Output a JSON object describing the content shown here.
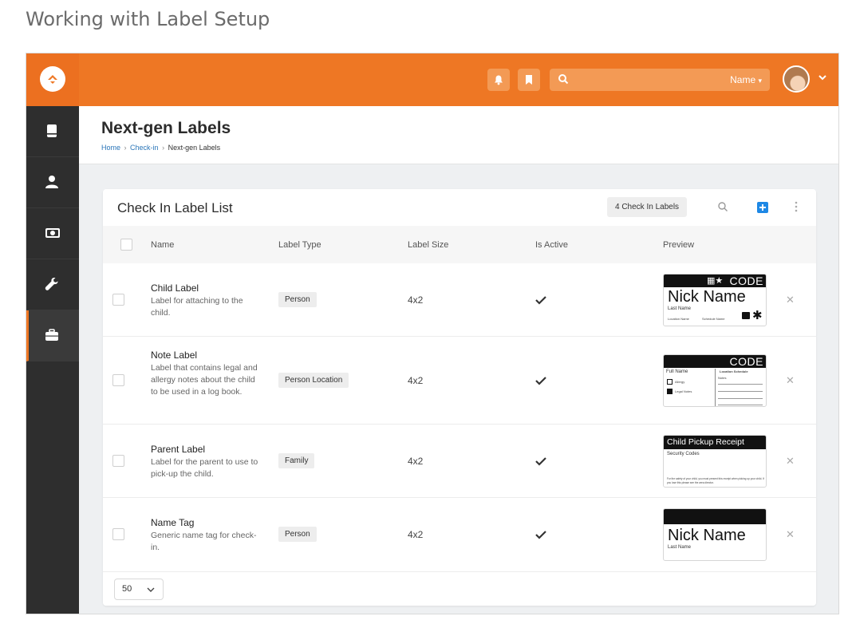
{
  "doc_title": "Working with Label Setup",
  "header": {
    "search_scope": "Name"
  },
  "page": {
    "title": "Next-gen Labels",
    "breadcrumb": [
      "Home",
      "Check-in",
      "Next-gen Labels"
    ]
  },
  "panel": {
    "title": "Check In Label List",
    "count_badge": "4 Check In Labels",
    "columns": [
      "Name",
      "Label Type",
      "Label Size",
      "Is Active",
      "Preview"
    ]
  },
  "rows": [
    {
      "name": "Child Label",
      "description": "Label for attaching to the child.",
      "type": "Person",
      "size": "4x2",
      "preview": {
        "code": "CODE",
        "big": "Nick Name",
        "line2": "Last Name",
        "f1": "Location Name",
        "f2": "Schedule Name"
      }
    },
    {
      "name": "Note Label",
      "description": "Label that contains legal and allergy notes about the child to be used in a log book.",
      "type": "Person Location",
      "size": "4x2",
      "preview": {
        "code": "CODE",
        "full_name": "Full Name",
        "loc": "Location Schedule",
        "allergy": "Allergy",
        "legal": "Legal Notes",
        "notes": "Notes"
      }
    },
    {
      "name": "Parent Label",
      "description": "Label for the parent to use to pick-up the child.",
      "type": "Family",
      "size": "4x2",
      "preview": {
        "title": "Child Pickup Receipt",
        "sub": "Security Codes",
        "fine": "For the safety of your child, you must present this receipt when picking up your child. If you lose this please see the area director."
      }
    },
    {
      "name": "Name Tag",
      "description": "Generic name tag for check-in.",
      "type": "Person",
      "size": "4x2",
      "preview": {
        "big": "Nick Name",
        "line2": "Last Name"
      }
    }
  ],
  "footer": {
    "page_size": "50"
  },
  "colors": {
    "brand": "#ee7724",
    "sidebar": "#2e2e2e",
    "link": "#2b76b9",
    "add": "#1e88e5"
  }
}
